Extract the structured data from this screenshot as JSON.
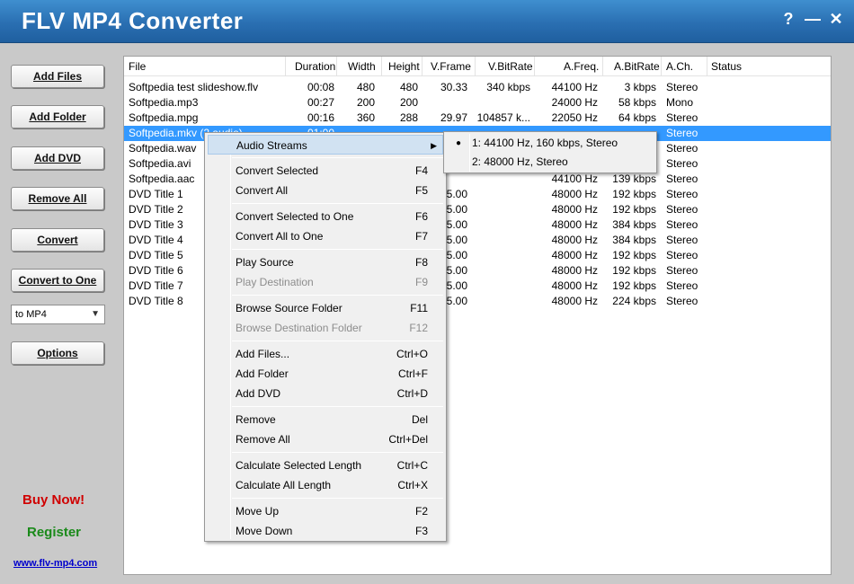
{
  "app": {
    "title": "FLV MP4 Converter",
    "help_label": "?",
    "minimize_label": "—",
    "close_label": "✕"
  },
  "sidebar": {
    "add_files": "Add Files",
    "add_folder": "Add Folder",
    "add_dvd": "Add DVD",
    "remove_all": "Remove All",
    "convert": "Convert",
    "convert_to_one": "Convert to One",
    "format_selected": "to MP4",
    "options": "Options",
    "buy_now": "Buy Now!",
    "register": "Register",
    "website": "www.flv-mp4.com"
  },
  "table": {
    "columns": [
      "File",
      "Duration",
      "Width",
      "Height",
      "V.Frame",
      "V.BitRate",
      "A.Freq.",
      "A.BitRate",
      "A.Ch.",
      "Status"
    ],
    "rows": [
      {
        "file": "Softpedia test slideshow.flv",
        "duration": "00:08",
        "width": "480",
        "height": "480",
        "vframe": "30.33",
        "vbitrate": "340 kbps",
        "afreq": "44100 Hz",
        "abitrate": "3 kbps",
        "ach": "Stereo",
        "status": ""
      },
      {
        "file": "Softpedia.mp3",
        "duration": "00:27",
        "width": "200",
        "height": "200",
        "vframe": "",
        "vbitrate": "",
        "afreq": "24000 Hz",
        "abitrate": "58 kbps",
        "ach": "Mono",
        "status": ""
      },
      {
        "file": "Softpedia.mpg",
        "duration": "00:16",
        "width": "360",
        "height": "288",
        "vframe": "29.97",
        "vbitrate": "104857 k...",
        "afreq": "22050 Hz",
        "abitrate": "64 kbps",
        "ach": "Stereo",
        "status": ""
      },
      {
        "file": "Softpedia.mkv (2 audio)",
        "duration": "01:00",
        "width": "",
        "height": "",
        "vframe": "",
        "vbitrate": "",
        "afreq": "",
        "abitrate": "",
        "ach": "Stereo",
        "status": "",
        "selected": true
      },
      {
        "file": "Softpedia.wav",
        "duration": "",
        "width": "",
        "height": "",
        "vframe": "",
        "vbitrate": "",
        "afreq": "",
        "abitrate": "",
        "ach": "Stereo",
        "status": ""
      },
      {
        "file": "Softpedia.avi",
        "duration": "",
        "width": "",
        "height": "",
        "vframe": "",
        "vbitrate": "",
        "afreq": "",
        "abitrate": "",
        "ach": "Stereo",
        "status": ""
      },
      {
        "file": "Softpedia.aac",
        "duration": "",
        "width": "",
        "height": "",
        "vframe": "",
        "vbitrate": "",
        "afreq": "44100 Hz",
        "abitrate": "139 kbps",
        "ach": "Stereo",
        "status": ""
      },
      {
        "file": "DVD Title 1",
        "duration": "",
        "width": "",
        "height": "",
        "vframe": "25.00",
        "vbitrate": "",
        "afreq": "48000 Hz",
        "abitrate": "192 kbps",
        "ach": "Stereo",
        "status": ""
      },
      {
        "file": "DVD Title 2",
        "duration": "",
        "width": "",
        "height": "",
        "vframe": "25.00",
        "vbitrate": "",
        "afreq": "48000 Hz",
        "abitrate": "192 kbps",
        "ach": "Stereo",
        "status": ""
      },
      {
        "file": "DVD Title 3",
        "duration": "",
        "width": "",
        "height": "",
        "vframe": "25.00",
        "vbitrate": "",
        "afreq": "48000 Hz",
        "abitrate": "384 kbps",
        "ach": "Stereo",
        "status": ""
      },
      {
        "file": "DVD Title 4",
        "duration": "",
        "width": "",
        "height": "",
        "vframe": "25.00",
        "vbitrate": "",
        "afreq": "48000 Hz",
        "abitrate": "384 kbps",
        "ach": "Stereo",
        "status": ""
      },
      {
        "file": "DVD Title 5",
        "duration": "",
        "width": "",
        "height": "",
        "vframe": "25.00",
        "vbitrate": "",
        "afreq": "48000 Hz",
        "abitrate": "192 kbps",
        "ach": "Stereo",
        "status": ""
      },
      {
        "file": "DVD Title 6",
        "duration": "",
        "width": "",
        "height": "",
        "vframe": "25.00",
        "vbitrate": "",
        "afreq": "48000 Hz",
        "abitrate": "192 kbps",
        "ach": "Stereo",
        "status": ""
      },
      {
        "file": "DVD Title 7",
        "duration": "",
        "width": "",
        "height": "",
        "vframe": "25.00",
        "vbitrate": "",
        "afreq": "48000 Hz",
        "abitrate": "192 kbps",
        "ach": "Stereo",
        "status": ""
      },
      {
        "file": "DVD Title 8",
        "duration": "",
        "width": "",
        "height": "",
        "vframe": "25.00",
        "vbitrate": "",
        "afreq": "48000 Hz",
        "abitrate": "224 kbps",
        "ach": "Stereo",
        "status": ""
      }
    ]
  },
  "context_menu": {
    "items": [
      {
        "label": "Audio Streams",
        "shortcut": "",
        "submenu": true,
        "hover": true
      },
      {
        "sep": true
      },
      {
        "label": "Convert Selected",
        "shortcut": "F4"
      },
      {
        "label": "Convert All",
        "shortcut": "F5"
      },
      {
        "sep": true
      },
      {
        "label": "Convert Selected to One",
        "shortcut": "F6"
      },
      {
        "label": "Convert All to One",
        "shortcut": "F7"
      },
      {
        "sep": true
      },
      {
        "label": "Play Source",
        "shortcut": "F8"
      },
      {
        "label": "Play Destination",
        "shortcut": "F9",
        "disabled": true
      },
      {
        "sep": true
      },
      {
        "label": "Browse Source Folder",
        "shortcut": "F11"
      },
      {
        "label": "Browse Destination Folder",
        "shortcut": "F12",
        "disabled": true
      },
      {
        "sep": true
      },
      {
        "label": "Add Files...",
        "shortcut": "Ctrl+O"
      },
      {
        "label": "Add Folder",
        "shortcut": "Ctrl+F"
      },
      {
        "label": "Add DVD",
        "shortcut": "Ctrl+D"
      },
      {
        "sep": true
      },
      {
        "label": "Remove",
        "shortcut": "Del"
      },
      {
        "label": "Remove All",
        "shortcut": "Ctrl+Del"
      },
      {
        "sep": true
      },
      {
        "label": "Calculate Selected Length",
        "shortcut": "Ctrl+C"
      },
      {
        "label": "Calculate All Length",
        "shortcut": "Ctrl+X"
      },
      {
        "sep": true
      },
      {
        "label": "Move Up",
        "shortcut": "F2"
      },
      {
        "label": "Move Down",
        "shortcut": "F3"
      }
    ],
    "audio_submenu": [
      {
        "label": "1: 44100 Hz, 160 kbps, Stereo",
        "checked": true
      },
      {
        "label": "2: 48000 Hz, Stereo",
        "checked": false
      }
    ]
  },
  "colors": {
    "titlebar": "#2a6fb2",
    "selection": "#3399ff",
    "buy_now": "#d00000",
    "register": "#1a8a1a",
    "link": "#0000cc"
  }
}
